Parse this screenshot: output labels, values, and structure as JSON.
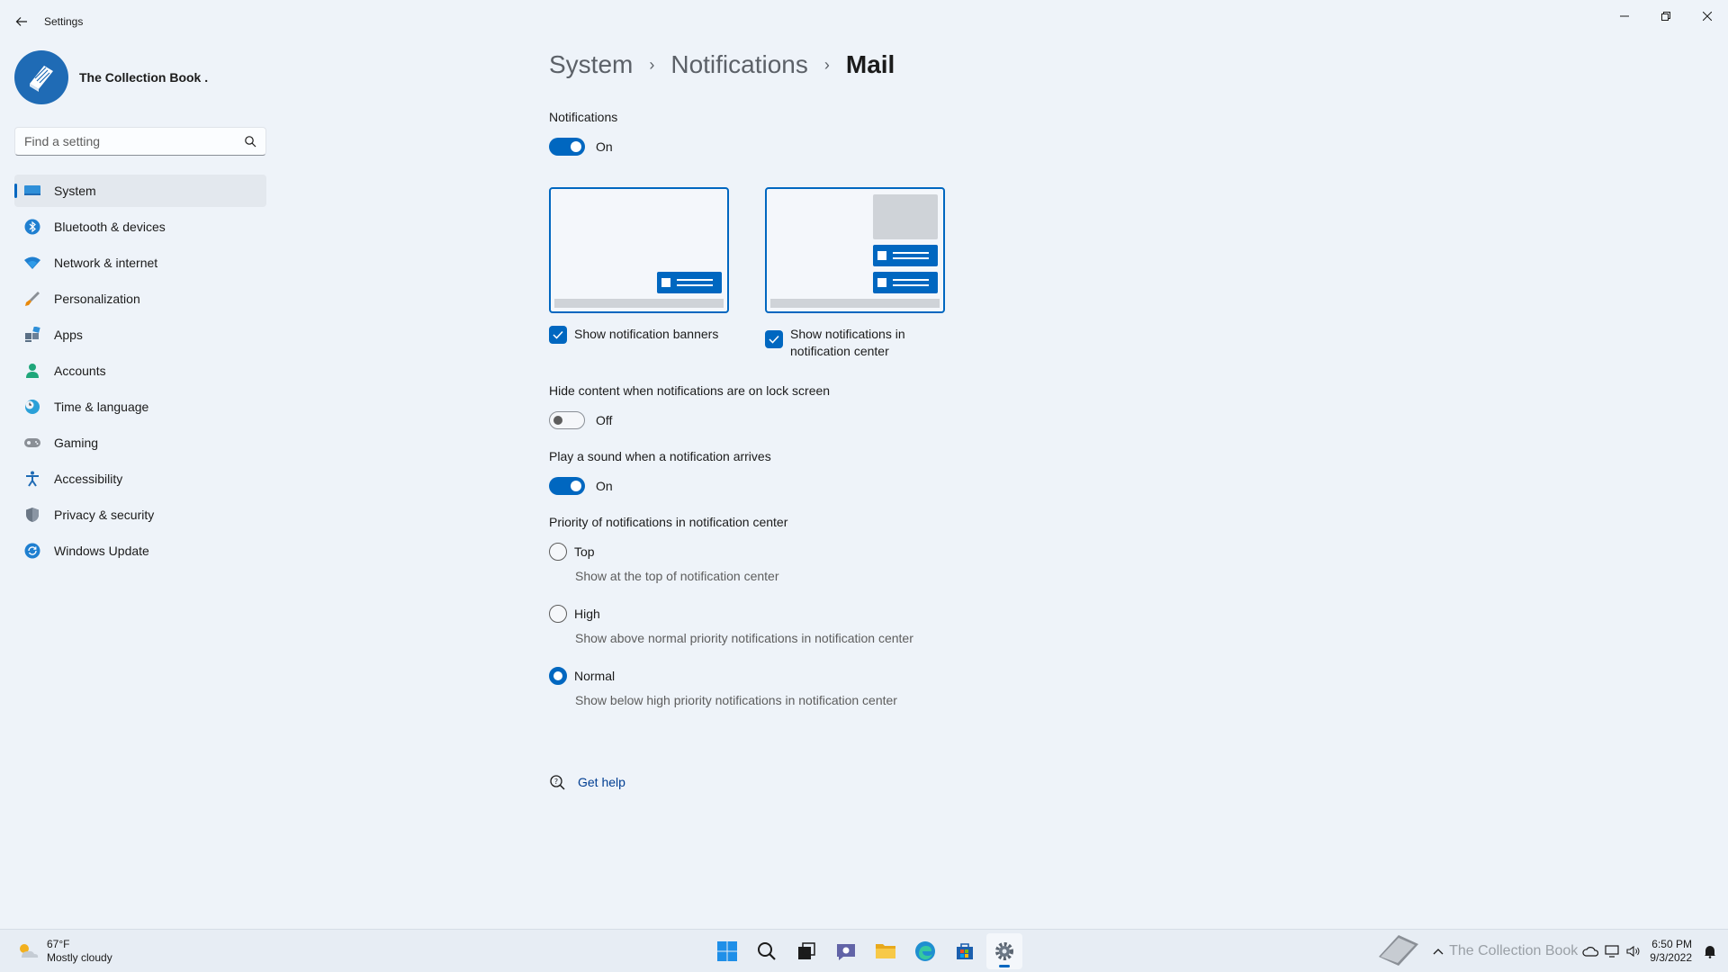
{
  "app": {
    "title": "Settings"
  },
  "profile": {
    "name": "The Collection Book ."
  },
  "search": {
    "placeholder": "Find a setting"
  },
  "sidebar": {
    "items": [
      {
        "label": "System",
        "icon": "monitor-icon",
        "active": true
      },
      {
        "label": "Bluetooth & devices",
        "icon": "bluetooth-icon"
      },
      {
        "label": "Network & internet",
        "icon": "wifi-icon"
      },
      {
        "label": "Personalization",
        "icon": "brush-icon"
      },
      {
        "label": "Apps",
        "icon": "apps-icon"
      },
      {
        "label": "Accounts",
        "icon": "person-icon"
      },
      {
        "label": "Time & language",
        "icon": "globe-clock-icon"
      },
      {
        "label": "Gaming",
        "icon": "gamepad-icon"
      },
      {
        "label": "Accessibility",
        "icon": "accessibility-icon"
      },
      {
        "label": "Privacy & security",
        "icon": "shield-icon"
      },
      {
        "label": "Windows Update",
        "icon": "update-icon"
      }
    ]
  },
  "breadcrumb": {
    "level1": "System",
    "level2": "Notifications",
    "level3": "Mail"
  },
  "notifications": {
    "label": "Notifications",
    "state": "On",
    "enabled": true
  },
  "options": {
    "banners_label": "Show notification banners",
    "banners_checked": true,
    "center_label": "Show notifications in notification center",
    "center_checked": true
  },
  "lockscreen": {
    "label": "Hide content when notifications are on lock screen",
    "state": "Off",
    "enabled": false
  },
  "sound": {
    "label": "Play a sound when a notification arrives",
    "state": "On",
    "enabled": true
  },
  "priority": {
    "label": "Priority of notifications in notification center",
    "options": [
      {
        "label": "Top",
        "desc": "Show at the top of notification center",
        "checked": false
      },
      {
        "label": "High",
        "desc": "Show above normal priority notifications in notification center",
        "checked": false
      },
      {
        "label": "Normal",
        "desc": "Show below high priority notifications in notification center",
        "checked": true
      }
    ]
  },
  "help": {
    "label": "Get help"
  },
  "taskbar": {
    "weather_temp": "67°F",
    "weather_desc": "Mostly cloudy",
    "apps": [
      "start-icon",
      "search-icon",
      "task-view-icon",
      "chat-icon",
      "file-explorer-icon",
      "edge-icon",
      "store-icon",
      "settings-icon"
    ],
    "watermark": "The Collection Book",
    "time": "6:50 PM",
    "date": "9/3/2022"
  },
  "colors": {
    "accent": "#0067c0",
    "background": "#eef3f9"
  }
}
